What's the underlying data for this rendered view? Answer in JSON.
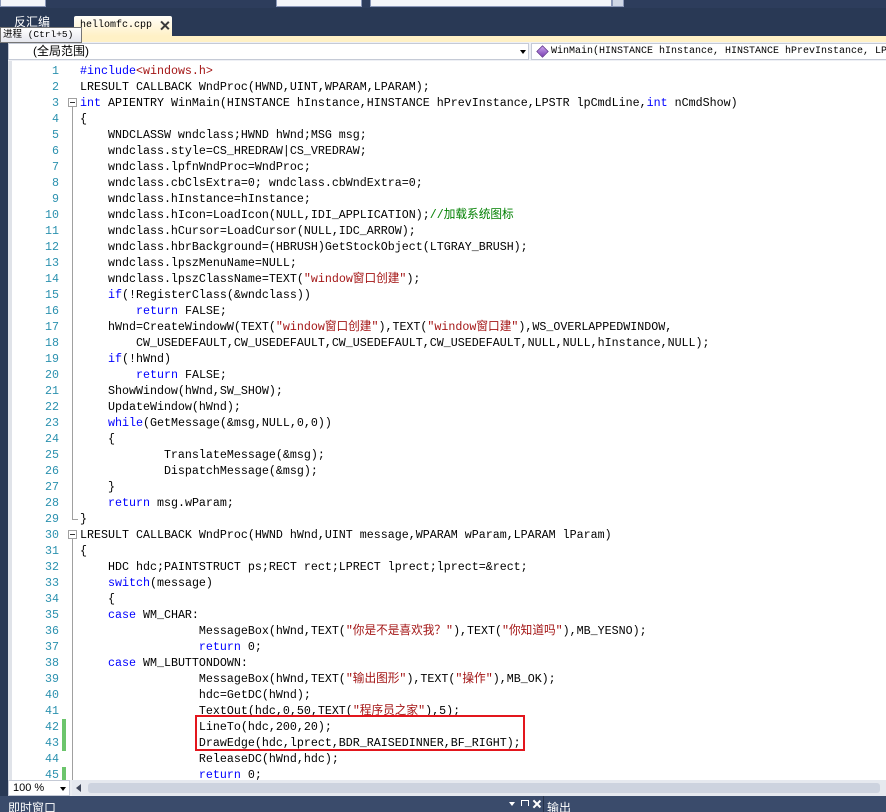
{
  "tabs": {
    "inactive_label": "反汇编",
    "active_label": "hellomfc.cpp"
  },
  "tooltip": {
    "text": "进程 (Ctrl+5)"
  },
  "nav_bar": {
    "scope_value": "(全局范围)",
    "member_value": "WinMain(HINSTANCE hInstance, HINSTANCE hPrevInstance, LP",
    "member_icon": "method-icon"
  },
  "editor": {
    "colors": {
      "keyword": "#0000ff",
      "string": "#a31515",
      "comment": "#008000",
      "text": "#000000",
      "line_number": "#2b91af",
      "changed": "#6cc56c"
    },
    "lines": [
      {
        "num": "1",
        "segs": [
          [
            "kw",
            "#include"
          ],
          [
            "str",
            "<windows.h>"
          ]
        ]
      },
      {
        "num": "2",
        "segs": [
          [
            "tx",
            "LRESULT CALLBACK WndProc(HWND,UINT,WPARAM,LPARAM);"
          ]
        ]
      },
      {
        "num": "3",
        "fold": "start",
        "segs": [
          [
            "kw",
            "int"
          ],
          [
            "tx",
            " APIENTRY WinMain(HINSTANCE hInstance,HINSTANCE hPrevInstance,LPSTR lpCmdLine,"
          ],
          [
            "kw",
            "int"
          ],
          [
            "tx",
            " nCmdShow)"
          ]
        ]
      },
      {
        "num": "4",
        "segs": [
          [
            "tx",
            "{"
          ]
        ]
      },
      {
        "num": "5",
        "segs": [
          [
            "tx",
            "    WNDCLASSW wndclass;HWND hWnd;MSG msg;"
          ]
        ]
      },
      {
        "num": "6",
        "segs": [
          [
            "tx",
            "    wndclass.style=CS_HREDRAW|CS_VREDRAW;"
          ]
        ]
      },
      {
        "num": "7",
        "segs": [
          [
            "tx",
            "    wndclass.lpfnWndProc=WndProc;"
          ]
        ]
      },
      {
        "num": "8",
        "segs": [
          [
            "tx",
            "    wndclass.cbClsExtra=0; wndclass.cbWndExtra=0;"
          ]
        ]
      },
      {
        "num": "9",
        "segs": [
          [
            "tx",
            "    wndclass.hInstance=hInstance;"
          ]
        ]
      },
      {
        "num": "10",
        "segs": [
          [
            "tx",
            "    wndclass.hIcon=LoadIcon(NULL,IDI_APPLICATION);"
          ],
          [
            "cm",
            "//加载系统图标"
          ]
        ]
      },
      {
        "num": "11",
        "segs": [
          [
            "tx",
            "    wndclass.hCursor=LoadCursor(NULL,IDC_ARROW);"
          ]
        ]
      },
      {
        "num": "12",
        "segs": [
          [
            "tx",
            "    wndclass.hbrBackground=(HBRUSH)GetStockObject(LTGRAY_BRUSH);"
          ]
        ]
      },
      {
        "num": "13",
        "segs": [
          [
            "tx",
            "    wndclass.lpszMenuName=NULL;"
          ]
        ]
      },
      {
        "num": "14",
        "segs": [
          [
            "tx",
            "    wndclass.lpszClassName=TEXT("
          ],
          [
            "str",
            "\"window窗口创建\""
          ],
          [
            "tx",
            ");"
          ]
        ]
      },
      {
        "num": "15",
        "segs": [
          [
            "tx",
            "    "
          ],
          [
            "kw",
            "if"
          ],
          [
            "tx",
            "(!RegisterClass(&wndclass))"
          ]
        ]
      },
      {
        "num": "16",
        "segs": [
          [
            "tx",
            "        "
          ],
          [
            "kw",
            "return"
          ],
          [
            "tx",
            " FALSE;"
          ]
        ]
      },
      {
        "num": "17",
        "segs": [
          [
            "tx",
            "    hWnd=CreateWindowW(TEXT("
          ],
          [
            "str",
            "\"window窗口创建\""
          ],
          [
            "tx",
            "),TEXT("
          ],
          [
            "str",
            "\"window窗口建\""
          ],
          [
            "tx",
            "),WS_OVERLAPPEDWINDOW,"
          ]
        ]
      },
      {
        "num": "18",
        "segs": [
          [
            "tx",
            "        CW_USEDEFAULT,CW_USEDEFAULT,CW_USEDEFAULT,CW_USEDEFAULT,NULL,NULL,hInstance,NULL);"
          ]
        ]
      },
      {
        "num": "19",
        "segs": [
          [
            "tx",
            "    "
          ],
          [
            "kw",
            "if"
          ],
          [
            "tx",
            "(!hWnd)"
          ]
        ]
      },
      {
        "num": "20",
        "segs": [
          [
            "tx",
            "        "
          ],
          [
            "kw",
            "return"
          ],
          [
            "tx",
            " FALSE;"
          ]
        ]
      },
      {
        "num": "21",
        "segs": [
          [
            "tx",
            "    ShowWindow(hWnd,SW_SHOW);"
          ]
        ]
      },
      {
        "num": "22",
        "segs": [
          [
            "tx",
            "    UpdateWindow(hWnd);"
          ]
        ]
      },
      {
        "num": "23",
        "segs": [
          [
            "tx",
            "    "
          ],
          [
            "kw",
            "while"
          ],
          [
            "tx",
            "(GetMessage(&msg,NULL,0,0))"
          ]
        ]
      },
      {
        "num": "24",
        "segs": [
          [
            "tx",
            "    {"
          ]
        ]
      },
      {
        "num": "25",
        "segs": [
          [
            "tx",
            "            TranslateMessage(&msg);"
          ]
        ]
      },
      {
        "num": "26",
        "segs": [
          [
            "tx",
            "            DispatchMessage(&msg);"
          ]
        ]
      },
      {
        "num": "27",
        "segs": [
          [
            "tx",
            "    }"
          ]
        ]
      },
      {
        "num": "28",
        "segs": [
          [
            "tx",
            "    "
          ],
          [
            "kw",
            "return"
          ],
          [
            "tx",
            " msg.wParam;"
          ]
        ]
      },
      {
        "num": "29",
        "fold": "end",
        "segs": [
          [
            "tx",
            "}"
          ]
        ]
      },
      {
        "num": "30",
        "fold": "start",
        "segs": [
          [
            "tx",
            "LRESULT CALLBACK WndProc(HWND hWnd,UINT message,WPARAM wParam,LPARAM lParam)"
          ]
        ]
      },
      {
        "num": "31",
        "segs": [
          [
            "tx",
            "{"
          ]
        ]
      },
      {
        "num": "32",
        "segs": [
          [
            "tx",
            "    HDC hdc;PAINTSTRUCT ps;RECT rect;LPRECT lprect;lprect=&rect;"
          ]
        ]
      },
      {
        "num": "33",
        "segs": [
          [
            "tx",
            "    "
          ],
          [
            "kw",
            "switch"
          ],
          [
            "tx",
            "(message)"
          ]
        ]
      },
      {
        "num": "34",
        "segs": [
          [
            "tx",
            "    {"
          ]
        ]
      },
      {
        "num": "35",
        "segs": [
          [
            "tx",
            "    "
          ],
          [
            "kw",
            "case"
          ],
          [
            "tx",
            " WM_CHAR:"
          ]
        ]
      },
      {
        "num": "36",
        "segs": [
          [
            "tx",
            "                 MessageBox(hWnd,TEXT("
          ],
          [
            "str",
            "\"你是不是喜欢我？\""
          ],
          [
            "tx",
            "),TEXT("
          ],
          [
            "str",
            "\"你知道吗\""
          ],
          [
            "tx",
            "),MB_YESNO);"
          ]
        ]
      },
      {
        "num": "37",
        "segs": [
          [
            "tx",
            "                 "
          ],
          [
            "kw",
            "return"
          ],
          [
            "tx",
            " 0;"
          ]
        ]
      },
      {
        "num": "38",
        "segs": [
          [
            "tx",
            "    "
          ],
          [
            "kw",
            "case"
          ],
          [
            "tx",
            " WM_LBUTTONDOWN:"
          ]
        ]
      },
      {
        "num": "39",
        "segs": [
          [
            "tx",
            "                 MessageBox(hWnd,TEXT("
          ],
          [
            "str",
            "\"输出图形\""
          ],
          [
            "tx",
            "),TEXT("
          ],
          [
            "str",
            "\"操作\""
          ],
          [
            "tx",
            "),MB_OK);"
          ]
        ]
      },
      {
        "num": "40",
        "segs": [
          [
            "tx",
            "                 hdc=GetDC(hWnd);"
          ]
        ]
      },
      {
        "num": "41",
        "segs": [
          [
            "tx",
            "                 TextOut(hdc,0,50,TEXT("
          ],
          [
            "str",
            "\"程序员之家\""
          ],
          [
            "tx",
            "),5);"
          ]
        ]
      },
      {
        "num": "42",
        "changed": true,
        "segs": [
          [
            "tx",
            "                 LineTo(hdc,200,20);"
          ]
        ]
      },
      {
        "num": "43",
        "changed": true,
        "segs": [
          [
            "tx",
            "                 DrawEdge(hdc,lprect,BDR_RAISEDINNER,BF_RIGHT);"
          ]
        ]
      },
      {
        "num": "44",
        "segs": [
          [
            "tx",
            "                 ReleaseDC(hWnd,hdc);"
          ]
        ]
      },
      {
        "num": "45",
        "changed": true,
        "segs": [
          [
            "tx",
            "                 "
          ],
          [
            "kw",
            "return"
          ],
          [
            "tx",
            " 0;"
          ]
        ]
      }
    ]
  },
  "status": {
    "zoom": "100 %"
  },
  "bottom_panels": {
    "immediate_title": "即时窗口",
    "output_title": "输出"
  },
  "annotation": {
    "color": "#e3161d"
  }
}
